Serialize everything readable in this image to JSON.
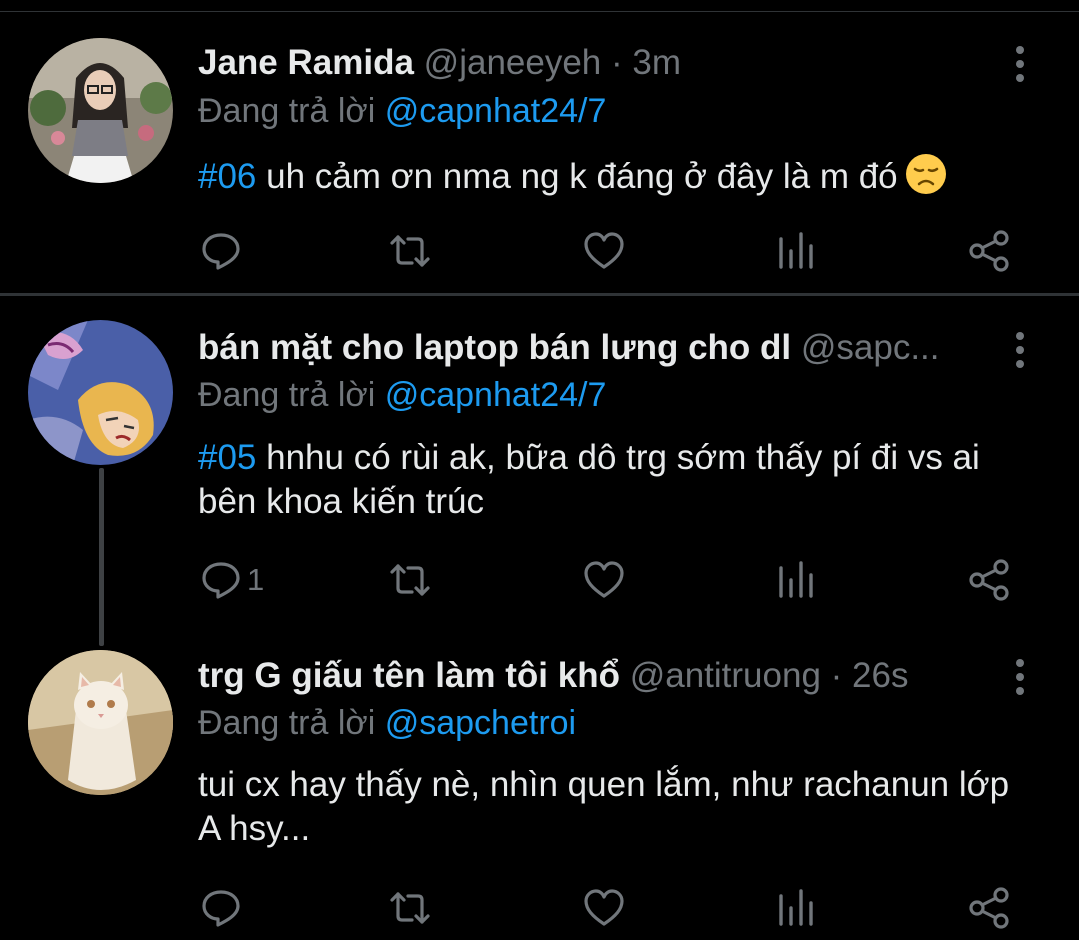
{
  "tweets": [
    {
      "name": "Jane Ramida",
      "handle": "@janeeyeh",
      "dot": "·",
      "time": "3m",
      "replying_prefix": "Đang trả lời",
      "replying_to": "@capnhat24/7",
      "hashtag": "#06",
      "text": " uh cảm ơn nma ng k đáng ở đây là m đó",
      "emoji": "disappointed-face",
      "reply_count": ""
    },
    {
      "name": "bán mặt cho laptop bán lưng cho dl",
      "handle": "@sapc...",
      "dot": "",
      "time": "",
      "replying_prefix": "Đang trả lời",
      "replying_to": "@capnhat24/7",
      "hashtag": "#05",
      "text": " hnhu có rùi ak, bữa dô trg sớm thấy pí đi vs ai bên khoa kiến trúc",
      "reply_count": "1"
    },
    {
      "name": "trg G giấu tên làm tôi khổ",
      "handle": "@antitruong",
      "dot": "·",
      "time": "26s",
      "replying_prefix": "Đang trả lời",
      "replying_to": "@sapchetroi",
      "hashtag": "",
      "text": "tui cx hay thấy nè, nhìn quen lắm, như rachanun lớp A hsy...",
      "reply_count": ""
    }
  ],
  "icons": {
    "reply": "reply-icon",
    "retweet": "retweet-icon",
    "like": "heart-icon",
    "views": "views-icon",
    "share": "share-icon",
    "more": "more-icon"
  },
  "colors": {
    "background": "#000000",
    "text": "#e7e9ea",
    "secondary": "#71767b",
    "accent": "#1d9bf0",
    "divider": "#2f3336"
  }
}
